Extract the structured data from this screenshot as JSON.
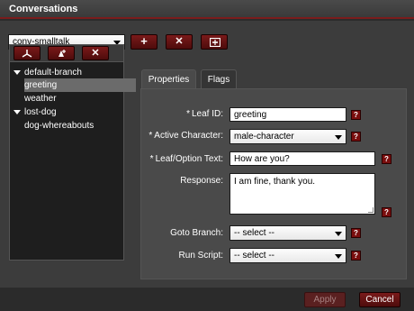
{
  "window": {
    "title": "Conversations"
  },
  "conversation_select": {
    "value": "conv-smalltalk"
  },
  "toolbar": {
    "add_label": "+",
    "delete_label": "✕"
  },
  "tree": {
    "nodes": [
      {
        "label": "default-branch",
        "type": "branch",
        "expanded": true
      },
      {
        "label": "greeting",
        "type": "leaf",
        "selected": true
      },
      {
        "label": "weather",
        "type": "leaf"
      },
      {
        "label": "lost-dog",
        "type": "branch",
        "expanded": true
      },
      {
        "label": "dog-whereabouts",
        "type": "leaf"
      }
    ]
  },
  "tabs": [
    {
      "label": "Properties",
      "active": true
    },
    {
      "label": "Flags",
      "active": false
    }
  ],
  "form": {
    "leaf_id": {
      "label": "Leaf ID:",
      "required": "*",
      "value": "greeting"
    },
    "active_character": {
      "label": "Active Character:",
      "required": "*",
      "value": "male-character"
    },
    "leaf_text": {
      "label": "Leaf/Option Text:",
      "required": "*",
      "value": "How are you?"
    },
    "response": {
      "label": "Response:",
      "value": "I am fine, thank you."
    },
    "goto_branch": {
      "label": "Goto Branch:",
      "value": "-- select --"
    },
    "run_script": {
      "label": "Run Script:",
      "value": "-- select --"
    },
    "help_glyph": "?"
  },
  "footer": {
    "apply_label": "Apply",
    "cancel_label": "Cancel"
  },
  "colors": {
    "accent": "#7a1a1a",
    "panel": "#4a4a4a",
    "background": "#3c3c3c"
  }
}
